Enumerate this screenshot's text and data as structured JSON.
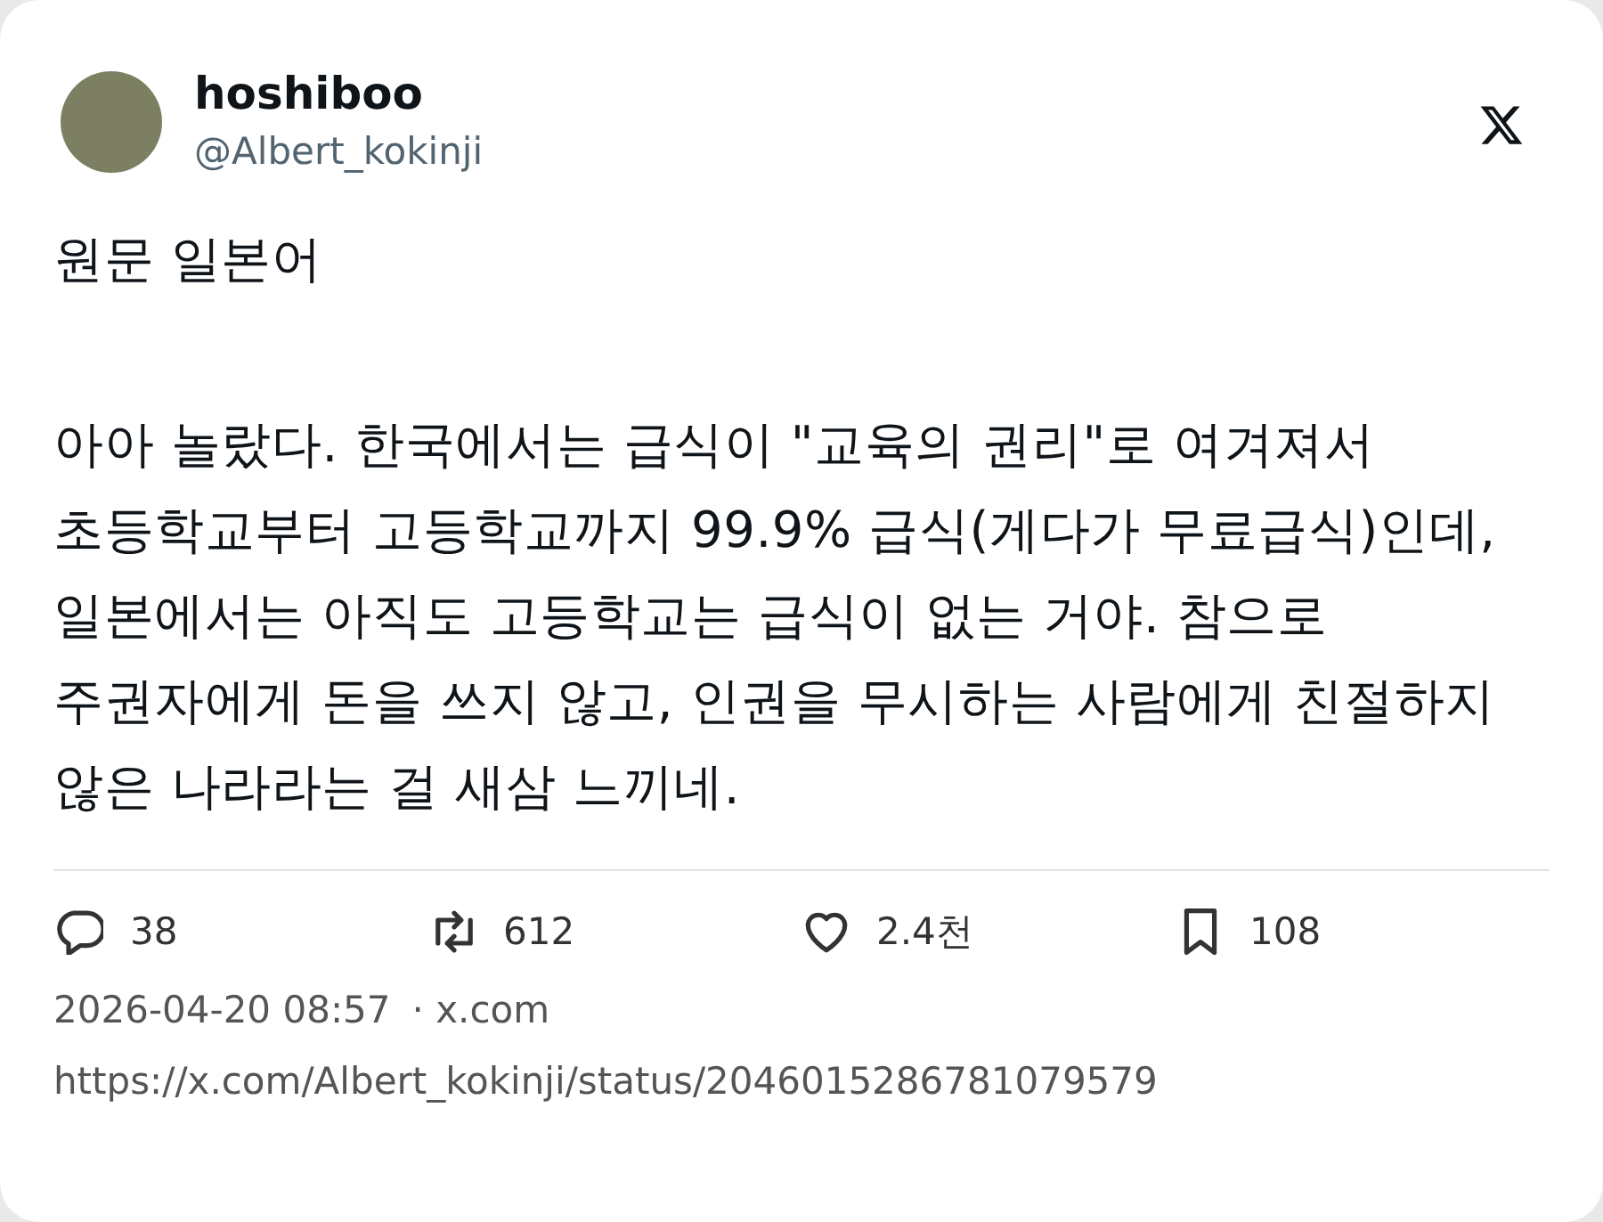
{
  "author": {
    "name": "hoshiboo",
    "handle": "@Albert_kokinji"
  },
  "paragraphs": [
    "원문 일본어",
    "아아 놀랐다. 한국에서는 급식이 \"교육의 권리\"로 여겨져서 초등학교부터 고등학교까지 99.9% 급식(게다가 무료급식)인데, 일본에서는 아직도 고등학교는 급식이 없는 거야. 참으로 주권자에게 돈을 쓰지 않고, 인권을 무시하는 사람에게 친절하지 않은 나라라는 걸 새삼 느끼네."
  ],
  "metrics": [
    {
      "kind": "reply",
      "count": "38"
    },
    {
      "kind": "repost",
      "count": "612"
    },
    {
      "kind": "like",
      "count": "2.4천"
    },
    {
      "kind": "bookmark",
      "count": "108"
    }
  ],
  "timestamp": "2026-04-20 08:57",
  "source": "· x.com",
  "url": "https://x.com/Albert_kokinji/status/2046015286781079579"
}
